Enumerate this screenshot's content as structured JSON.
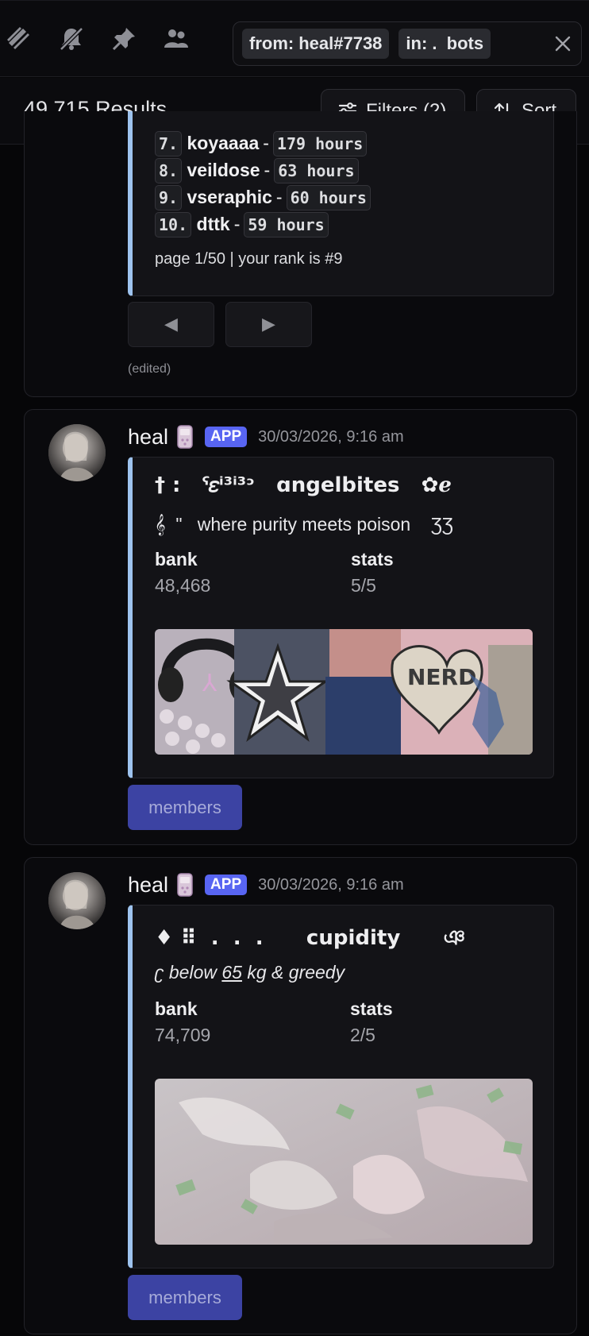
{
  "search": {
    "chips": [
      {
        "key": "from:",
        "value": "heal#7738"
      },
      {
        "key": "in:",
        "value": ".  bots"
      }
    ]
  },
  "results": {
    "count": "49,715 Results",
    "filters_label": "Filters (2)",
    "sort_label": "Sort"
  },
  "card1": {
    "rows": [
      {
        "rank": "7.",
        "name": "koyaaaa",
        "value": "179 hours"
      },
      {
        "rank": "8.",
        "name": "veildose",
        "value": "63 hours"
      },
      {
        "rank": "9.",
        "name": "vseraphic",
        "value": "60 hours"
      },
      {
        "rank": "10.",
        "name": "dttk",
        "value": "59 hours"
      }
    ],
    "dash": "-",
    "page_text": "page 1/50 | your rank is #9",
    "prev": "◀",
    "next": "▶",
    "edited": "(edited)"
  },
  "card2": {
    "author": "heal",
    "badge": "APP",
    "timestamp": "30/03/2026, 9:16 am",
    "title": "† :   ˁ𝜀ⁱ³ⁱ³ᵓ   ɑngelbites   ✿ℯ",
    "description": "𝄞  \"   where purity meets poison    ƷƷ",
    "field1_label": "bank",
    "field1_value": "48,468",
    "field2_label": "stats",
    "field2_value": "5/5",
    "button": "members"
  },
  "card3": {
    "author": "heal",
    "badge": "APP",
    "timestamp": "30/03/2026, 9:16 am",
    "title": "♦ ⠿  .  .  .      cupidity      ঞ",
    "desc_prefix": "ʗ below ",
    "desc_num": "65",
    "desc_suffix": " kg & greedy",
    "field1_label": "bank",
    "field1_value": "74,709",
    "field2_label": "stats",
    "field2_value": "2/5",
    "button": "members"
  }
}
